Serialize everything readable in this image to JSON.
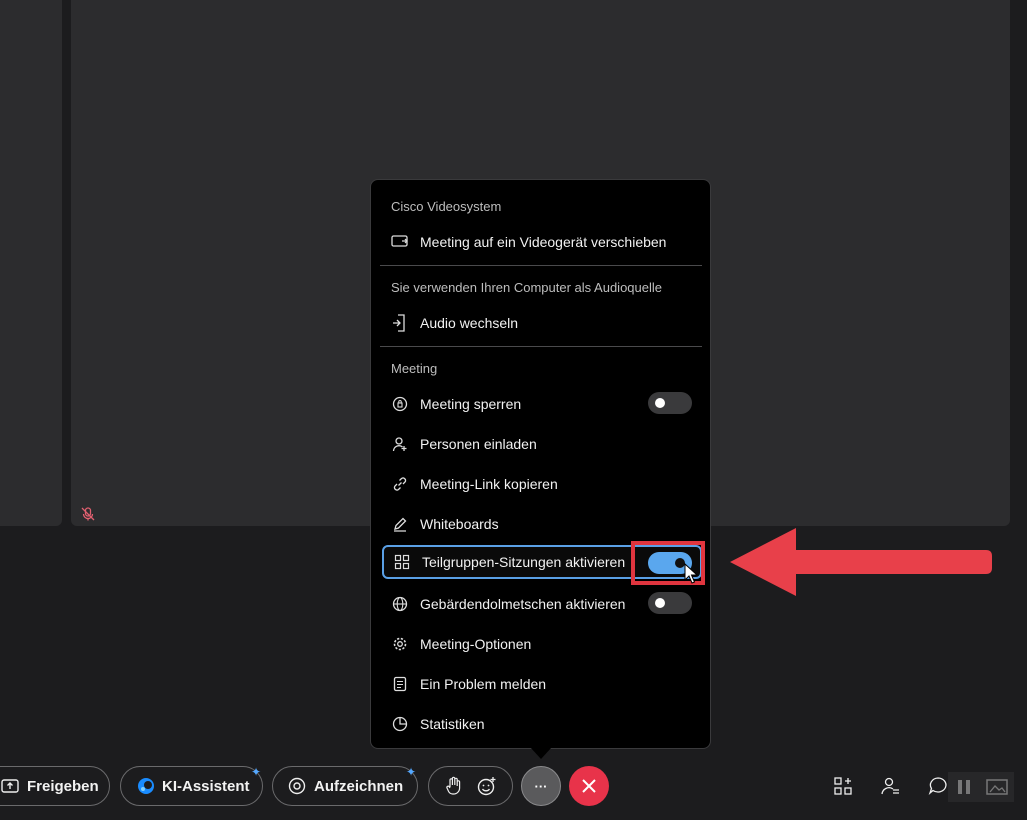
{
  "menu": {
    "section_video": "Cisco Videosystem",
    "move_meeting": "Meeting auf ein Videogerät verschieben",
    "section_audio": "Sie verwenden Ihren Computer als Audioquelle",
    "switch_audio": "Audio wechseln",
    "section_meeting": "Meeting",
    "items": [
      {
        "label": "Meeting sperren",
        "icon": "lock-icon",
        "toggle": true,
        "on": false
      },
      {
        "label": "Personen einladen",
        "icon": "invite-person-icon"
      },
      {
        "label": "Meeting-Link kopieren",
        "icon": "link-icon"
      },
      {
        "label": "Whiteboards",
        "icon": "pencil-icon"
      },
      {
        "label": "Teilgruppen-Sitzungen aktivieren",
        "icon": "breakout-grid-icon",
        "toggle": true,
        "on": true
      },
      {
        "label": "Gebärdendolmetschen aktivieren",
        "icon": "globe-icon",
        "toggle": true,
        "on": false
      },
      {
        "label": "Meeting-Optionen",
        "icon": "gear-icon"
      },
      {
        "label": "Ein Problem melden",
        "icon": "report-icon"
      },
      {
        "label": "Statistiken",
        "icon": "statistics-icon"
      }
    ]
  },
  "toolbar": {
    "share": "Freigeben",
    "ai_assistant": "KI-Assistent",
    "record": "Aufzeichnen",
    "more": "···",
    "spark": "✦"
  },
  "colors": {
    "accent": "#5aa7ee",
    "highlight": "#e0353f",
    "end_call": "#e8334a"
  }
}
